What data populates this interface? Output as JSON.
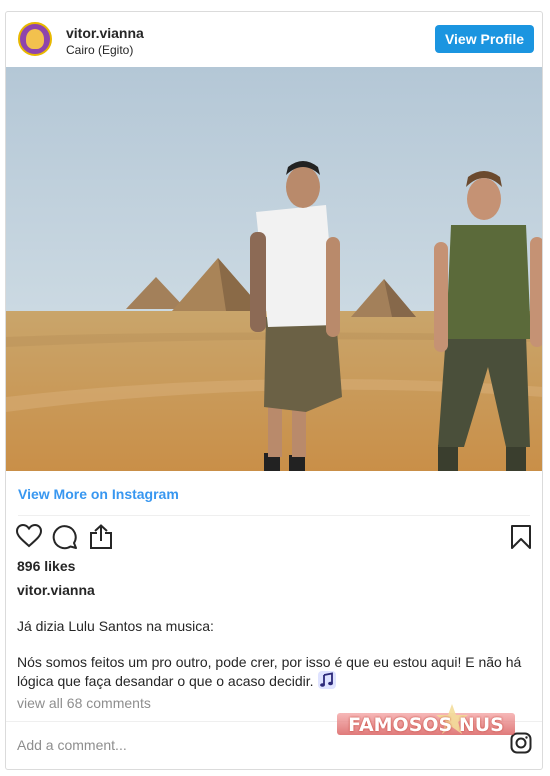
{
  "header": {
    "username": "vitor.vianna",
    "location": "Cairo (Egito)",
    "view_profile_label": "View Profile"
  },
  "post": {
    "view_more_label": "View More on Instagram",
    "likes": "896 likes",
    "caption_user": "vitor.vianna",
    "caption_line1": "Já dizia Lulu Santos na musica:",
    "caption_line2": "Nós somos feitos um pro outro, pode crer, por isso é que eu estou aqui! E não há lógica que faça desandar o que o acaso decidir.",
    "view_comments": "view all 68 comments",
    "add_comment_placeholder": "Add a comment..."
  },
  "watermark": {
    "text": "FAMOSOS NUS"
  },
  "icons": {
    "like": "heart-icon",
    "comment": "comment-icon",
    "share": "share-icon",
    "save": "bookmark-icon",
    "music": "music-note-icon",
    "instagram": "instagram-icon"
  },
  "colors": {
    "accent": "#1b95e0",
    "link": "#3897f0",
    "text": "#262626",
    "muted": "#8e8e8e",
    "border": "#dbdbdb"
  }
}
